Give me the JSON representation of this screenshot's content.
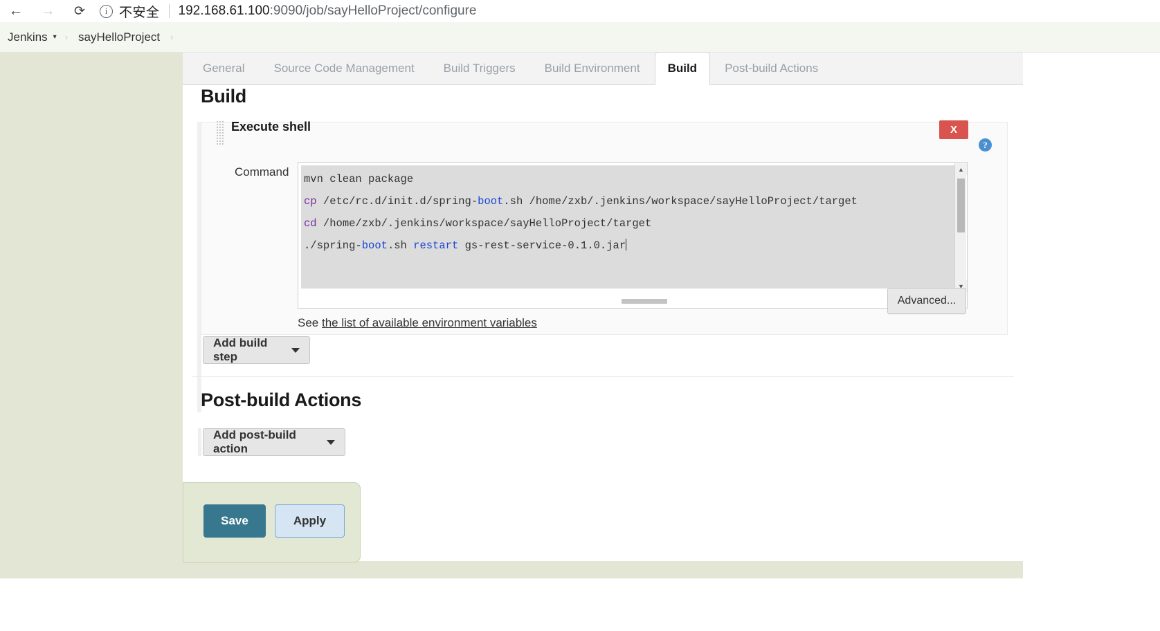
{
  "browser": {
    "back_icon": "arrow-left-icon",
    "forward_icon": "arrow-right-icon",
    "reload_icon": "reload-icon",
    "info_icon": "info-circle-icon",
    "security_label": "不安全",
    "url_host": "192.168.61.100",
    "url_rest": ":9090/job/sayHelloProject/configure"
  },
  "breadcrumb": {
    "root": "Jenkins",
    "project": "sayHelloProject",
    "arrow": "›",
    "caret": "▾"
  },
  "tabs": [
    {
      "label": "General",
      "active": false
    },
    {
      "label": "Source Code Management",
      "active": false
    },
    {
      "label": "Build Triggers",
      "active": false
    },
    {
      "label": "Build Environment",
      "active": false
    },
    {
      "label": "Build",
      "active": true
    },
    {
      "label": "Post-build Actions",
      "active": false
    }
  ],
  "build_section": {
    "title": "Build",
    "step": {
      "heading": "Execute shell",
      "grip_icon": "drag-handle-icon",
      "delete_label": "X",
      "help_label": "?",
      "command_label": "Command",
      "command_lines": [
        {
          "tokens": [
            {
              "t": "mvn clean package",
              "c": "plain"
            }
          ]
        },
        {
          "tokens": [
            {
              "t": "cp",
              "c": "cmd"
            },
            {
              "t": " /etc/rc.d/init.d/spring-",
              "c": "plain"
            },
            {
              "t": "boot",
              "c": "kw"
            },
            {
              "t": ".sh /home/zxb/.jenkins/workspace/sayHelloProject/target",
              "c": "plain"
            }
          ]
        },
        {
          "tokens": [
            {
              "t": "cd",
              "c": "cmd"
            },
            {
              "t": " /home/zxb/.jenkins/workspace/sayHelloProject/target",
              "c": "plain"
            }
          ]
        },
        {
          "tokens": [
            {
              "t": "./spring-",
              "c": "plain"
            },
            {
              "t": "boot",
              "c": "kw"
            },
            {
              "t": ".sh ",
              "c": "plain"
            },
            {
              "t": "restart",
              "c": "kw"
            },
            {
              "t": " gs-rest-service-0",
              "c": "plain"
            },
            {
              "t": ".1.0.jar",
              "c": "plain"
            }
          ]
        }
      ],
      "env_text_before": "See ",
      "env_link_text": "the list of available environment variables",
      "advanced_label": "Advanced..."
    },
    "add_build_step_label": "Add build step"
  },
  "postbuild_section": {
    "title": "Post-build Actions",
    "add_postbuild_label": "Add post-build action"
  },
  "footer": {
    "save_label": "Save",
    "apply_label": "Apply"
  },
  "colors": {
    "accent_teal": "#37788f",
    "apply_blue": "#d5e5f4",
    "delete_red": "#d9534f",
    "help_blue": "#4b8fd1",
    "page_bg": "#e3e6d4",
    "token_command": "#7a2fa0",
    "token_keyword": "#1a44d6"
  }
}
